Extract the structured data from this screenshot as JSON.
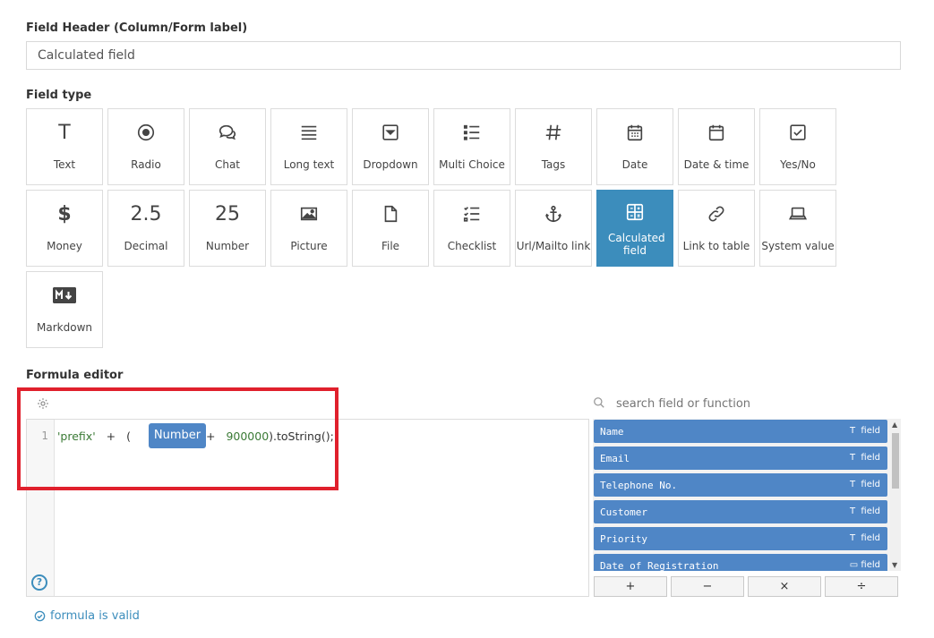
{
  "field_header": {
    "label": "Field Header (Column/Form label)",
    "value": "Calculated field"
  },
  "field_type": {
    "label": "Field type",
    "tiles": [
      {
        "label": "Text",
        "icon": "text-icon"
      },
      {
        "label": "Radio",
        "icon": "radio-icon"
      },
      {
        "label": "Chat",
        "icon": "chat-icon"
      },
      {
        "label": "Long text",
        "icon": "long-text-icon"
      },
      {
        "label": "Dropdown",
        "icon": "dropdown-icon"
      },
      {
        "label": "Multi Choice",
        "icon": "multi-choice-icon"
      },
      {
        "label": "Tags",
        "icon": "hash-icon"
      },
      {
        "label": "Date",
        "icon": "calendar-icon"
      },
      {
        "label": "Date & time",
        "icon": "calendar-icon"
      },
      {
        "label": "Yes/No",
        "icon": "checkbox-icon"
      },
      {
        "label": "Money",
        "icon": "dollar-icon"
      },
      {
        "label": "Decimal",
        "icon": "decimal-icon",
        "glyph": "2.5"
      },
      {
        "label": "Number",
        "icon": "number-icon",
        "glyph": "25"
      },
      {
        "label": "Picture",
        "icon": "picture-icon"
      },
      {
        "label": "File",
        "icon": "file-icon"
      },
      {
        "label": "Checklist",
        "icon": "checklist-icon"
      },
      {
        "label": "Url/Mailto link",
        "icon": "anchor-icon"
      },
      {
        "label": "Calculated field",
        "icon": "calculated-icon",
        "active": true
      },
      {
        "label": "Link to table",
        "icon": "link-icon"
      },
      {
        "label": "System value",
        "icon": "laptop-icon"
      },
      {
        "label": "Markdown",
        "icon": "markdown-icon"
      }
    ]
  },
  "formula_editor": {
    "label": "Formula editor",
    "line_number": "1",
    "code_prefix": "'prefix'",
    "code_plus1": "+",
    "code_paren": "(",
    "token": "Number",
    "code_plus2": "+",
    "code_number": "900000",
    "code_suffix": ").toString();",
    "help_glyph": "?"
  },
  "field_search": {
    "placeholder": "search field or function",
    "items": [
      {
        "name": "Name",
        "type_glyph": "T",
        "type": "field"
      },
      {
        "name": "Email",
        "type_glyph": "T",
        "type": "field"
      },
      {
        "name": "Telephone No.",
        "type_glyph": "T",
        "type": "field"
      },
      {
        "name": "Customer",
        "type_glyph": "T",
        "type": "field"
      },
      {
        "name": "Priority",
        "type_glyph": "T",
        "type": "field"
      },
      {
        "name": "Date of Registration",
        "type_glyph": "▭",
        "type": "field"
      }
    ]
  },
  "operators": [
    "+",
    "−",
    "×",
    "÷"
  ],
  "status": {
    "text": "formula is valid"
  },
  "colors": {
    "accent": "#3c8dbc",
    "token": "#4f86c6",
    "highlight_box": "#e0202c"
  }
}
